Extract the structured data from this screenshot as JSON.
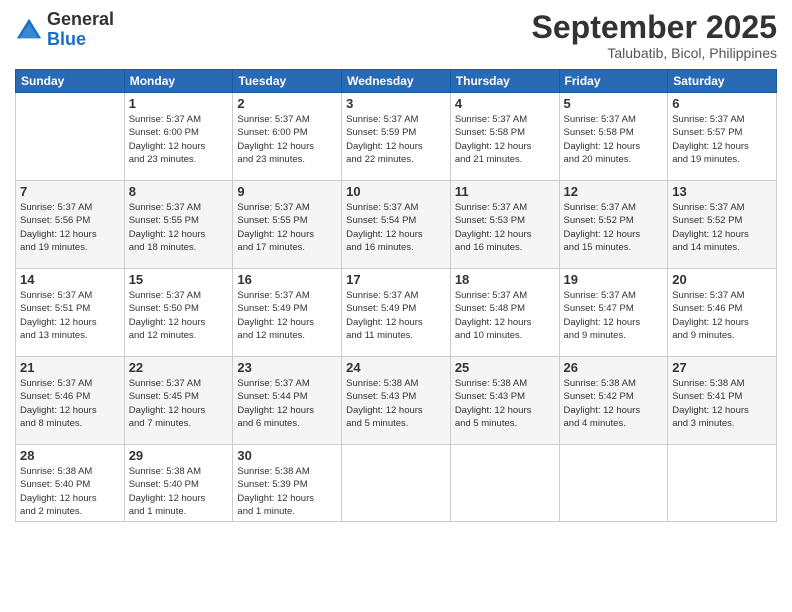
{
  "logo": {
    "general": "General",
    "blue": "Blue"
  },
  "header": {
    "month": "September 2025",
    "location": "Talubatib, Bicol, Philippines"
  },
  "weekdays": [
    "Sunday",
    "Monday",
    "Tuesday",
    "Wednesday",
    "Thursday",
    "Friday",
    "Saturday"
  ],
  "weeks": [
    [
      {
        "day": "",
        "info": ""
      },
      {
        "day": "1",
        "info": "Sunrise: 5:37 AM\nSunset: 6:00 PM\nDaylight: 12 hours\nand 23 minutes."
      },
      {
        "day": "2",
        "info": "Sunrise: 5:37 AM\nSunset: 6:00 PM\nDaylight: 12 hours\nand 23 minutes."
      },
      {
        "day": "3",
        "info": "Sunrise: 5:37 AM\nSunset: 5:59 PM\nDaylight: 12 hours\nand 22 minutes."
      },
      {
        "day": "4",
        "info": "Sunrise: 5:37 AM\nSunset: 5:58 PM\nDaylight: 12 hours\nand 21 minutes."
      },
      {
        "day": "5",
        "info": "Sunrise: 5:37 AM\nSunset: 5:58 PM\nDaylight: 12 hours\nand 20 minutes."
      },
      {
        "day": "6",
        "info": "Sunrise: 5:37 AM\nSunset: 5:57 PM\nDaylight: 12 hours\nand 19 minutes."
      }
    ],
    [
      {
        "day": "7",
        "info": "Sunrise: 5:37 AM\nSunset: 5:56 PM\nDaylight: 12 hours\nand 19 minutes."
      },
      {
        "day": "8",
        "info": "Sunrise: 5:37 AM\nSunset: 5:55 PM\nDaylight: 12 hours\nand 18 minutes."
      },
      {
        "day": "9",
        "info": "Sunrise: 5:37 AM\nSunset: 5:55 PM\nDaylight: 12 hours\nand 17 minutes."
      },
      {
        "day": "10",
        "info": "Sunrise: 5:37 AM\nSunset: 5:54 PM\nDaylight: 12 hours\nand 16 minutes."
      },
      {
        "day": "11",
        "info": "Sunrise: 5:37 AM\nSunset: 5:53 PM\nDaylight: 12 hours\nand 16 minutes."
      },
      {
        "day": "12",
        "info": "Sunrise: 5:37 AM\nSunset: 5:52 PM\nDaylight: 12 hours\nand 15 minutes."
      },
      {
        "day": "13",
        "info": "Sunrise: 5:37 AM\nSunset: 5:52 PM\nDaylight: 12 hours\nand 14 minutes."
      }
    ],
    [
      {
        "day": "14",
        "info": "Sunrise: 5:37 AM\nSunset: 5:51 PM\nDaylight: 12 hours\nand 13 minutes."
      },
      {
        "day": "15",
        "info": "Sunrise: 5:37 AM\nSunset: 5:50 PM\nDaylight: 12 hours\nand 12 minutes."
      },
      {
        "day": "16",
        "info": "Sunrise: 5:37 AM\nSunset: 5:49 PM\nDaylight: 12 hours\nand 12 minutes."
      },
      {
        "day": "17",
        "info": "Sunrise: 5:37 AM\nSunset: 5:49 PM\nDaylight: 12 hours\nand 11 minutes."
      },
      {
        "day": "18",
        "info": "Sunrise: 5:37 AM\nSunset: 5:48 PM\nDaylight: 12 hours\nand 10 minutes."
      },
      {
        "day": "19",
        "info": "Sunrise: 5:37 AM\nSunset: 5:47 PM\nDaylight: 12 hours\nand 9 minutes."
      },
      {
        "day": "20",
        "info": "Sunrise: 5:37 AM\nSunset: 5:46 PM\nDaylight: 12 hours\nand 9 minutes."
      }
    ],
    [
      {
        "day": "21",
        "info": "Sunrise: 5:37 AM\nSunset: 5:46 PM\nDaylight: 12 hours\nand 8 minutes."
      },
      {
        "day": "22",
        "info": "Sunrise: 5:37 AM\nSunset: 5:45 PM\nDaylight: 12 hours\nand 7 minutes."
      },
      {
        "day": "23",
        "info": "Sunrise: 5:37 AM\nSunset: 5:44 PM\nDaylight: 12 hours\nand 6 minutes."
      },
      {
        "day": "24",
        "info": "Sunrise: 5:38 AM\nSunset: 5:43 PM\nDaylight: 12 hours\nand 5 minutes."
      },
      {
        "day": "25",
        "info": "Sunrise: 5:38 AM\nSunset: 5:43 PM\nDaylight: 12 hours\nand 5 minutes."
      },
      {
        "day": "26",
        "info": "Sunrise: 5:38 AM\nSunset: 5:42 PM\nDaylight: 12 hours\nand 4 minutes."
      },
      {
        "day": "27",
        "info": "Sunrise: 5:38 AM\nSunset: 5:41 PM\nDaylight: 12 hours\nand 3 minutes."
      }
    ],
    [
      {
        "day": "28",
        "info": "Sunrise: 5:38 AM\nSunset: 5:40 PM\nDaylight: 12 hours\nand 2 minutes."
      },
      {
        "day": "29",
        "info": "Sunrise: 5:38 AM\nSunset: 5:40 PM\nDaylight: 12 hours\nand 1 minute."
      },
      {
        "day": "30",
        "info": "Sunrise: 5:38 AM\nSunset: 5:39 PM\nDaylight: 12 hours\nand 1 minute."
      },
      {
        "day": "",
        "info": ""
      },
      {
        "day": "",
        "info": ""
      },
      {
        "day": "",
        "info": ""
      },
      {
        "day": "",
        "info": ""
      }
    ]
  ]
}
